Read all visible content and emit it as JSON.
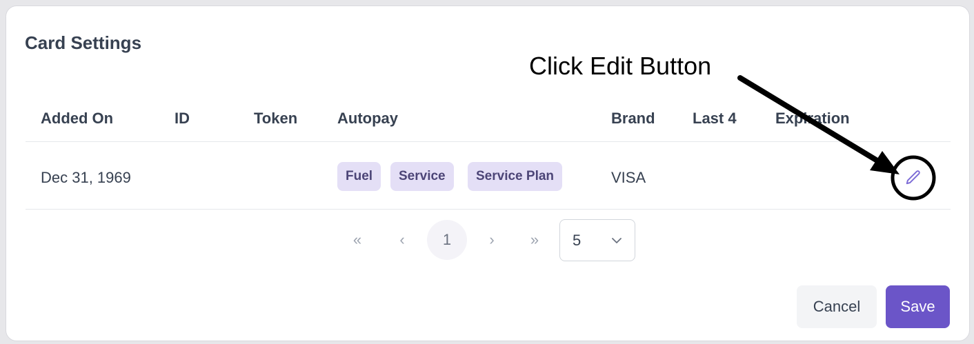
{
  "dialog": {
    "title": "Card Settings"
  },
  "annotation": {
    "text": "Click Edit Button"
  },
  "table": {
    "headers": {
      "added_on": "Added On",
      "id": "ID",
      "token": "Token",
      "autopay": "Autopay",
      "brand": "Brand",
      "last4": "Last 4",
      "expiration": "Expiration"
    },
    "rows": [
      {
        "added_on": "Dec 31, 1969",
        "id": "",
        "token": "",
        "autopay": [
          "Fuel",
          "Service",
          "Service Plan"
        ],
        "brand": "VISA",
        "last4": "",
        "expiration": ""
      }
    ]
  },
  "pagination": {
    "first": "«",
    "prev": "‹",
    "current_page": "1",
    "next": "›",
    "last": "»",
    "page_size": "5"
  },
  "footer": {
    "cancel_label": "Cancel",
    "save_label": "Save"
  },
  "icons": {
    "edit": "pencil-icon",
    "select": "chevron-down-icon"
  },
  "colors": {
    "accent": "#6b55c8",
    "badge_bg": "#e4dff6",
    "badge_text": "#4c4577"
  }
}
